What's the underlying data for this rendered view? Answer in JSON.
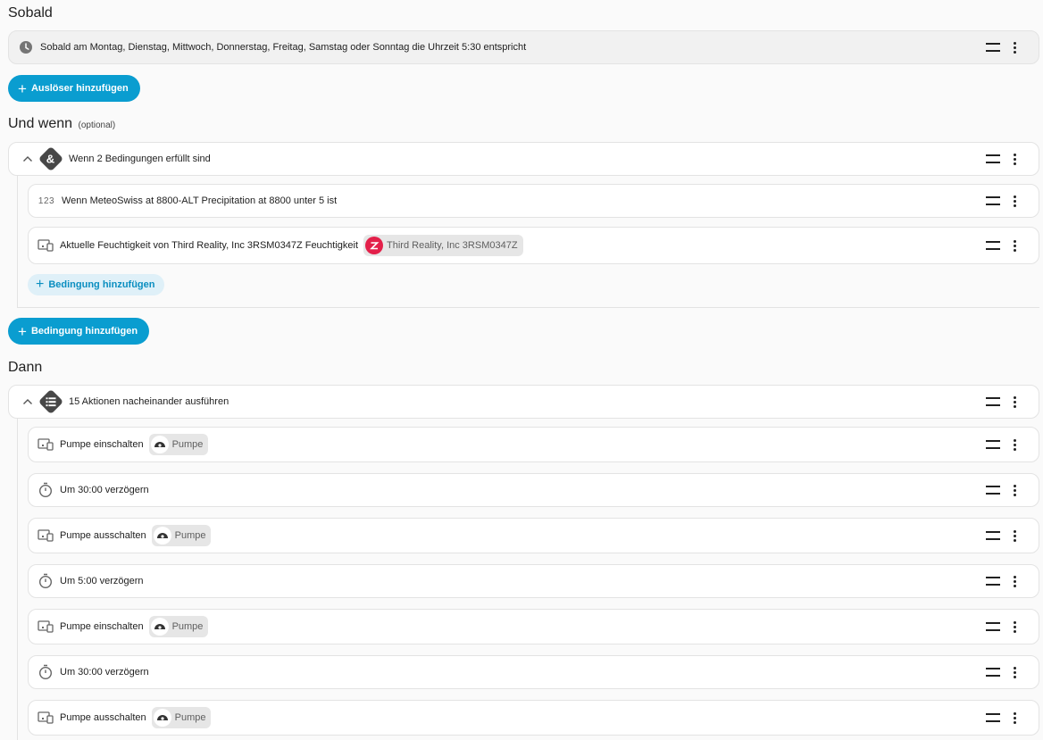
{
  "sections": {
    "trigger_title": "Sobald",
    "condition_title": "Und wenn",
    "condition_optional": "(optional)",
    "action_title": "Dann"
  },
  "trigger": {
    "label": "Sobald am Montag, Dienstag, Mittwoch, Donnerstag, Freitag, Samstag oder Sonntag die Uhrzeit 5:30 entspricht",
    "icon": "clock-icon"
  },
  "add_trigger_label": "Auslöser hinzufügen",
  "condition_group": {
    "label": "Wenn 2 Bedingungen erfüllt sind",
    "icon_glyph": "&"
  },
  "conditions": [
    {
      "label": "Wenn MeteoSwiss at 8800-ALT Precipitation at 8800 unter 5 ist",
      "icon": "numeric-icon",
      "icon_text": "123"
    },
    {
      "label": "Aktuelle Feuchtigkeit von Third Reality, Inc 3RSM0347Z Feuchtigkeit",
      "icon": "device-icon",
      "chip": "Third Reality, Inc 3RSM0347Z"
    }
  ],
  "add_condition_inner_label": "Bedingung hinzufügen",
  "add_condition_label": "Bedingung hinzufügen",
  "action_group": {
    "label": "15 Aktionen nacheinander ausführen"
  },
  "actions": [
    {
      "label": "Pumpe einschalten",
      "icon": "device-icon",
      "chip": "Pumpe"
    },
    {
      "label": "Um 30:00 verzögern",
      "icon": "timer-icon"
    },
    {
      "label": "Pumpe ausschalten",
      "icon": "device-icon",
      "chip": "Pumpe"
    },
    {
      "label": "Um 5:00 verzögern",
      "icon": "timer-icon"
    },
    {
      "label": "Pumpe einschalten",
      "icon": "device-icon",
      "chip": "Pumpe"
    },
    {
      "label": "Um 30:00 verzögern",
      "icon": "timer-icon"
    },
    {
      "label": "Pumpe ausschalten",
      "icon": "device-icon",
      "chip": "Pumpe"
    }
  ],
  "colors": {
    "primary_button": "#0a9dd0",
    "zigbee_red": "#e3204a"
  }
}
